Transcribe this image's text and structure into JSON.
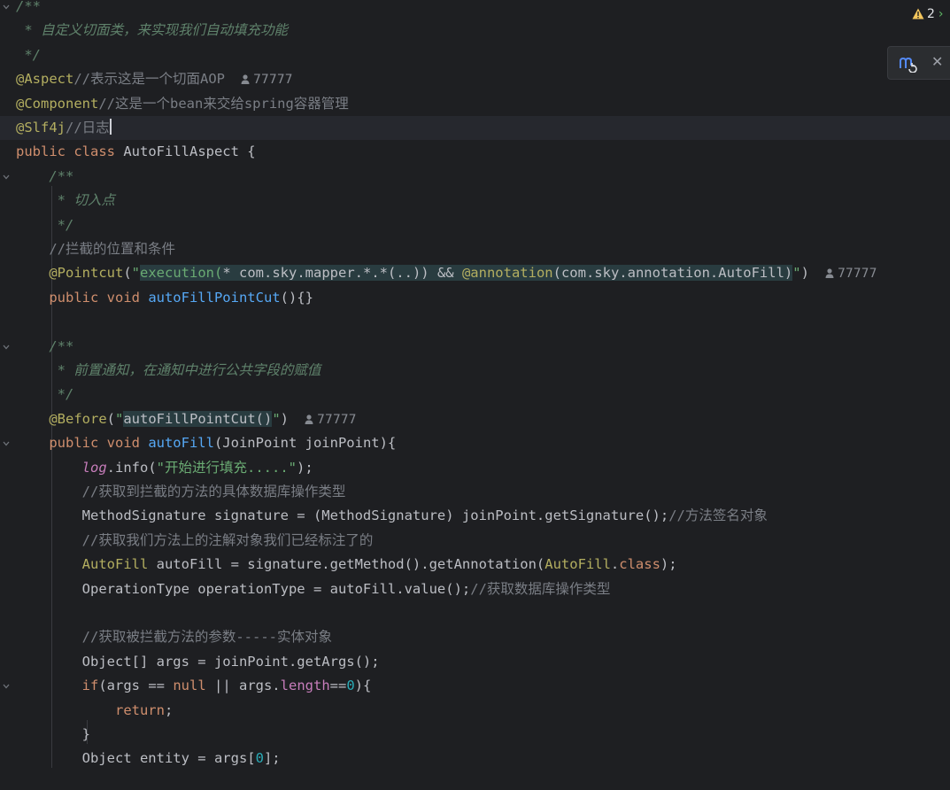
{
  "editor": {
    "inspection": {
      "icon": "warning-icon",
      "count": "2"
    },
    "ai_popup": {
      "icon": "refresh-assistant-icon",
      "close_icon": "close-icon",
      "close_glyph": "✕"
    },
    "author_hint": {
      "icon": "user-icon",
      "name": "77777"
    },
    "lines": [
      [
        [
          "doc",
          "/**"
        ]
      ],
      [
        [
          "doc",
          " * 自定义切面类，来实现我们自动填充功能"
        ]
      ],
      [
        [
          "doc",
          " */"
        ]
      ],
      [
        [
          "ann",
          "@Aspect"
        ],
        [
          "cmt",
          "//表示这是一个切面AOP"
        ]
      ],
      [
        [
          "ann",
          "@Component"
        ],
        [
          "cmt",
          "//这是一个bean来交给spring容器管理"
        ]
      ],
      [
        [
          "ann",
          "@Slf4j"
        ],
        [
          "cmt",
          "//日志"
        ]
      ],
      [
        [
          "kw",
          "public class "
        ],
        [
          "plain",
          "AutoFillAspect {"
        ]
      ],
      [
        [
          "doc",
          "    /**"
        ]
      ],
      [
        [
          "doc",
          "     * 切入点"
        ]
      ],
      [
        [
          "doc",
          "     */"
        ]
      ],
      [
        [
          "cmt",
          "    //拦截的位置和条件"
        ]
      ],
      [
        [
          "plain",
          "    "
        ],
        [
          "ann",
          "@Pointcut"
        ],
        [
          "plain",
          "("
        ],
        [
          "str",
          "\""
        ],
        [
          "str_inj",
          "execution("
        ],
        [
          "plain_inj",
          "* com.sky.mapper.*.*(..)) && "
        ],
        [
          "ann_inj",
          "@annotation"
        ],
        [
          "plain_inj",
          "(com.sky.annotation.AutoFill)"
        ],
        [
          "str",
          "\""
        ],
        [
          "plain",
          ")"
        ]
      ],
      [
        [
          "plain",
          "    "
        ],
        [
          "kw",
          "public void "
        ],
        [
          "fn",
          "autoFillPointCut"
        ],
        [
          "plain",
          "(){}"
        ]
      ],
      [
        [
          "plain",
          ""
        ]
      ],
      [
        [
          "doc",
          "    /**"
        ]
      ],
      [
        [
          "doc",
          "     * 前置通知，在通知中进行公共字段的赋值"
        ]
      ],
      [
        [
          "doc",
          "     */"
        ]
      ],
      [
        [
          "plain",
          "    "
        ],
        [
          "ann",
          "@Before"
        ],
        [
          "plain",
          "("
        ],
        [
          "str",
          "\""
        ],
        [
          "plain_inj",
          "autoFillPointCut()"
        ],
        [
          "str",
          "\""
        ],
        [
          "plain",
          ")"
        ]
      ],
      [
        [
          "plain",
          "    "
        ],
        [
          "kw",
          "public void "
        ],
        [
          "fn",
          "autoFill"
        ],
        [
          "plain",
          "(JoinPoint joinPoint){"
        ]
      ],
      [
        [
          "plain",
          "        "
        ],
        [
          "logf",
          "log"
        ],
        [
          "plain",
          ".info("
        ],
        [
          "str",
          "\"开始进行填充.....\""
        ],
        [
          "plain",
          ");"
        ]
      ],
      [
        [
          "cmt",
          "        //获取到拦截的方法的具体数据库操作类型"
        ]
      ],
      [
        [
          "plain",
          "        MethodSignature signature = (MethodSignature) joinPoint.getSignature();"
        ],
        [
          "cmt",
          "//方法签名对象"
        ]
      ],
      [
        [
          "cmt",
          "        //获取我们方法上的注解对象我们已经标注了的"
        ]
      ],
      [
        [
          "plain",
          "        "
        ],
        [
          "ann",
          "AutoFill"
        ],
        [
          "plain",
          " autoFill = signature.getMethod().getAnnotation("
        ],
        [
          "ann",
          "AutoFill"
        ],
        [
          "plain",
          "."
        ],
        [
          "kw",
          "class"
        ],
        [
          "plain",
          ");"
        ]
      ],
      [
        [
          "plain",
          "        OperationType operationType = autoFill.value();"
        ],
        [
          "cmt",
          "//获取数据库操作类型"
        ]
      ],
      [
        [
          "plain",
          ""
        ]
      ],
      [
        [
          "cmt",
          "        //获取被拦截方法的参数-----实体对象"
        ]
      ],
      [
        [
          "plain",
          "        Object[] args = joinPoint.getArgs();"
        ]
      ],
      [
        [
          "plain",
          "        "
        ],
        [
          "kw",
          "if"
        ],
        [
          "plain",
          "(args == "
        ],
        [
          "kw",
          "null"
        ],
        [
          "plain",
          " || args."
        ],
        [
          "fld",
          "length"
        ],
        [
          "plain",
          "=="
        ],
        [
          "num",
          "0"
        ],
        [
          "plain",
          "){"
        ]
      ],
      [
        [
          "plain",
          "            "
        ],
        [
          "kw",
          "return"
        ],
        [
          "plain",
          ";"
        ]
      ],
      [
        [
          "plain",
          "        }"
        ]
      ],
      [
        [
          "plain",
          "        Object entity = args["
        ],
        [
          "num",
          "0"
        ],
        [
          "plain",
          "];"
        ]
      ]
    ]
  }
}
